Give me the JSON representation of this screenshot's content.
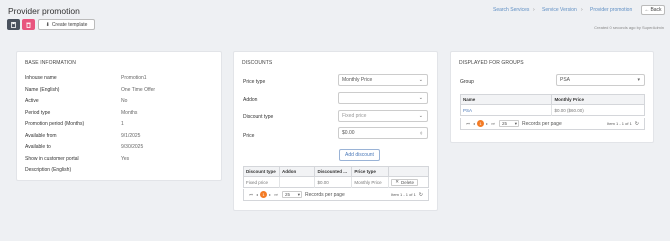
{
  "header": {
    "title": "Provider promotion",
    "back_label": "Back",
    "created_text": "Created 0 seconds ago by SuperAdmin",
    "create_template_label": "Create template",
    "breadcrumbs": [
      "Search Services",
      "Service Version",
      "Provider promotion"
    ]
  },
  "base_info": {
    "title": "BASE INFORMATION",
    "rows": [
      {
        "label": "Inhouse name",
        "value": "Promotion1"
      },
      {
        "label": "Name (English)",
        "value": "One Time Offer"
      },
      {
        "label": "Active",
        "value": "No"
      },
      {
        "label": "Period type",
        "value": "Months"
      },
      {
        "label": "Promotion period (Months)",
        "value": "1"
      },
      {
        "label": "Available from",
        "value": "9/1/2025"
      },
      {
        "label": "Available to",
        "value": "9/30/2025"
      },
      {
        "label": "Show in customer portal",
        "value": "Yes"
      },
      {
        "label": "Description (English)",
        "value": ""
      }
    ]
  },
  "discounts": {
    "title": "DISCOUNTS",
    "price_type_label": "Price type",
    "price_type_value": "Monthly Price",
    "addon_label": "Addon",
    "addon_value": "",
    "discount_type_label": "Discount type",
    "discount_type_placeholder": "Fixed price",
    "price_label": "Price",
    "price_value": "$0.00",
    "add_button": "Add discount",
    "table": {
      "headers": [
        "Discount type",
        "Addon",
        "Discounted ...",
        "Price type"
      ],
      "rows": [
        {
          "discount_type": "Fixed price",
          "addon": "",
          "discounted": "$0.00",
          "price_type": "Monthly Price",
          "action": "Delete"
        }
      ]
    },
    "pager": {
      "page": "1",
      "page_size": "25",
      "records_label": "Records per page",
      "info": "Item 1 - 1 of 1"
    }
  },
  "groups": {
    "title": "DISPLAYED FOR GROUPS",
    "group_label": "Group",
    "group_value": "PSA",
    "table": {
      "headers": [
        "Name",
        "Monthly Price"
      ],
      "rows": [
        {
          "name": "PSA",
          "price": "$0.00 ($60.00)"
        }
      ]
    },
    "pager": {
      "page": "1",
      "page_size": "25",
      "records_label": "Records per page",
      "info": "Item 1 - 1 of 1"
    }
  },
  "colors": {
    "accent_orange": "#f37b25",
    "link_blue": "#5f8fc4",
    "delete_pink": "#e8557e"
  }
}
